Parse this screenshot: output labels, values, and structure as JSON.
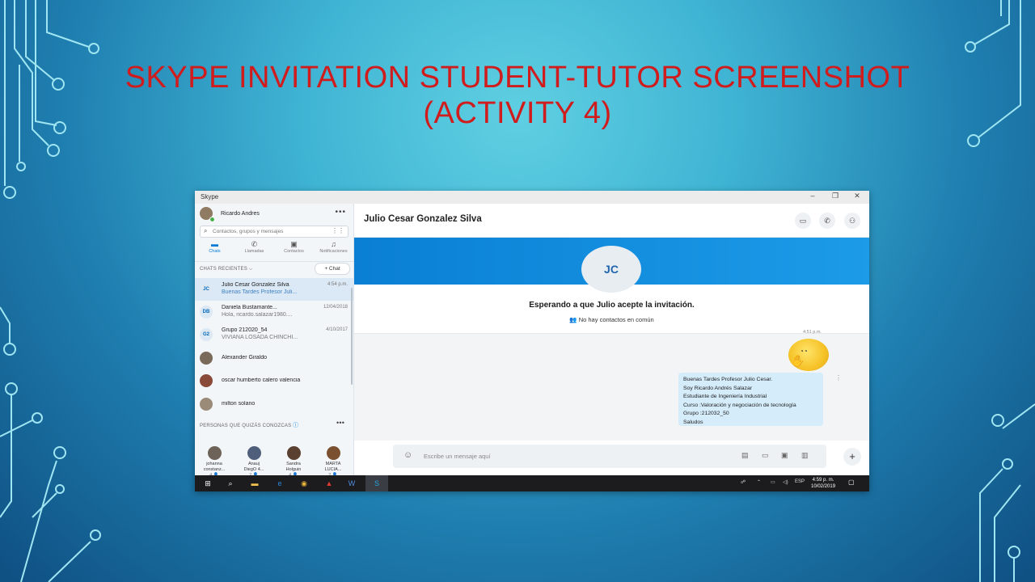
{
  "slide": {
    "title_line1": "SKYPE INVITATION STUDENT-TUTOR SCREENSHOT",
    "title_line2": "(ACTIVITY 4)",
    "title_color": "#d01c1c"
  },
  "window": {
    "app_title": "Skype",
    "controls": [
      "–",
      "❐",
      "✕"
    ]
  },
  "profile": {
    "name": "Ricardo Andres",
    "more": "•••"
  },
  "search": {
    "placeholder": "Contactos, grupos y mensajes"
  },
  "nav_tabs": [
    {
      "label": "Chats",
      "icon": "chat-icon",
      "active": true
    },
    {
      "label": "Llamadas",
      "icon": "phone-icon"
    },
    {
      "label": "Contactos",
      "icon": "contacts-icon"
    },
    {
      "label": "Notificaciones",
      "icon": "bell-icon"
    }
  ],
  "recent": {
    "header": "CHATS RECIENTES ⌵",
    "new_chat_label": "+ Chat",
    "items": [
      {
        "initials": "JC",
        "name": "Julio Cesar Gonzalez Silva",
        "preview": "Buenas Tardes Profesor Juli...",
        "date": "4:54 p.m."
      },
      {
        "initials": "DB",
        "name": "Daniela Bustamante...",
        "preview": "Hola, ricardo.salazar1980....",
        "date": "12/04/2018"
      },
      {
        "initials": "G2",
        "name": "Grupo 212020_54",
        "preview": "VIVIANA LOSADA CHINCHI...",
        "date": "4/10/2017"
      },
      {
        "initials": "",
        "name": "Alexander Giraldo",
        "preview": "",
        "date": ""
      },
      {
        "initials": "",
        "name": "oscar humberto calero valencia",
        "preview": "",
        "date": ""
      },
      {
        "initials": "",
        "name": "milton solano",
        "preview": "",
        "date": ""
      }
    ]
  },
  "suggested": {
    "header": "PERSONAS QUE QUIZÁS CONOZCAS",
    "more": "•••",
    "people": [
      {
        "line1": "johanna",
        "line2": "constanz...",
        "count": "4 👤"
      },
      {
        "line1": "Anauj",
        "line2": "DiegO 4...",
        "count": "2 👤"
      },
      {
        "line1": "Sandra",
        "line2": "Holguin",
        "count": "4 👤"
      },
      {
        "line1": "MARTA",
        "line2": "LUCIA...",
        "count": "2 👤"
      }
    ]
  },
  "conversation": {
    "contact_name": "Julio Cesar Gonzalez Silva",
    "contact_initials": "JC",
    "waiting_text": "Esperando a que Julio acepte la invitación.",
    "no_common": "👥 No hay contactos en común",
    "time": "4:51 p.m.",
    "message_lines": [
      "Buenas Tardes Profesor Julio Cesar.",
      "Soy Ricardo Andrés Salazar",
      "Estudiante de Ingeniería Industrial",
      "Curso :Valoración y negociación de tecnología",
      "Grupo :212032_50",
      "Saludos"
    ],
    "composer_placeholder": "Escribe un mensaje aquí",
    "colors": {
      "banner": "#0a7fd4",
      "bubble": "#d5ecfb"
    }
  },
  "taskbar": {
    "tray_text": "ESP",
    "time": "4:59 p. m.",
    "date": "10/02/2019",
    "notif_count": "1"
  }
}
